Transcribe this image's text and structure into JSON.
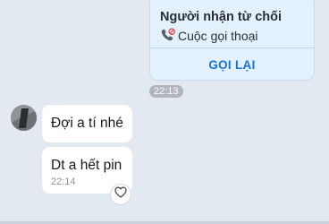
{
  "call_card": {
    "title": "Người nhận từ chối",
    "subtitle": "Cuộc gọi thoại",
    "callback_label": "GỌI LẠI"
  },
  "time_badge": "22:13",
  "messages": [
    {
      "text": "Đợi a tí nhé",
      "time": ""
    },
    {
      "text": "Dt a hết pin",
      "time": "22:14"
    }
  ],
  "colors": {
    "background": "#e2e9f1",
    "call_card": "#e3f1fd",
    "accent": "#1a73d9",
    "declined_icon": "#e5484d"
  },
  "icons": {
    "call": "phone-declined-icon",
    "reaction": "heart-icon"
  }
}
